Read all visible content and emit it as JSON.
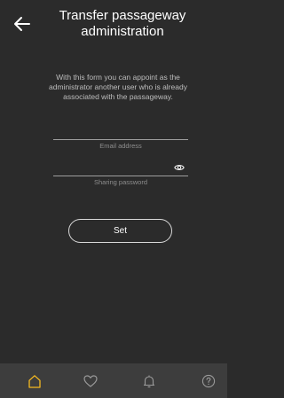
{
  "header": {
    "back_icon": "arrow-left-icon",
    "title": "Transfer passageway administration"
  },
  "description": "With this form you can appoint as the administrator another user who is already associated with the passageway.",
  "form": {
    "email": {
      "value": "",
      "label": "Email address"
    },
    "password": {
      "value": "",
      "label": "Sharing password",
      "toggle_icon": "eye-icon"
    },
    "submit_label": "Set"
  },
  "bottom_nav": {
    "items": [
      {
        "icon": "home-icon",
        "active": true
      },
      {
        "icon": "heart-icon",
        "active": false
      },
      {
        "icon": "bell-icon",
        "active": false
      },
      {
        "icon": "help-icon",
        "active": false
      }
    ]
  },
  "colors": {
    "background": "#2b2b2b",
    "nav_background": "#3d3d3d",
    "accent": "#f5b921",
    "inactive_icon": "#9a9a9a",
    "text": "#ffffff",
    "secondary_text": "#bdbdbd"
  }
}
